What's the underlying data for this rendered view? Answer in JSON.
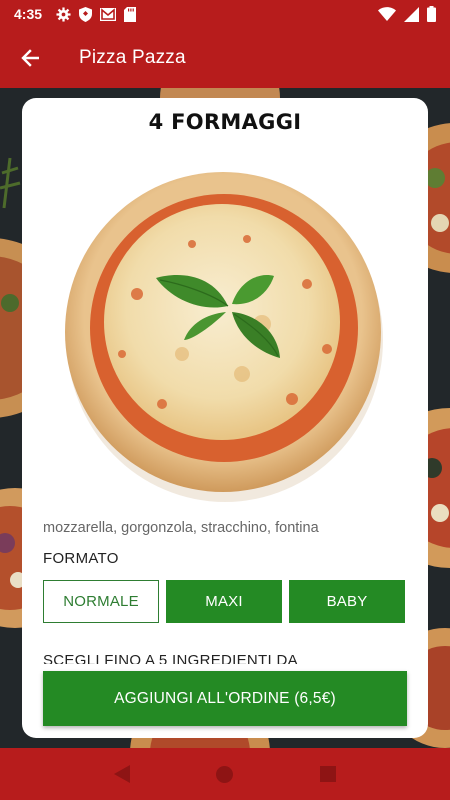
{
  "status_bar": {
    "time": "4:35",
    "left_icons": [
      "gear-icon",
      "shield-icon",
      "gmail-icon",
      "sd-card-icon"
    ],
    "right_icons": [
      "wifi-icon",
      "signal-icon",
      "battery-icon"
    ]
  },
  "app_bar": {
    "title": "Pizza Pazza",
    "back_icon": "arrow-left-icon"
  },
  "colors": {
    "primary": "#b71c1c",
    "accent_green": "#248a24"
  },
  "product": {
    "name": "4 FORMAGGI",
    "ingredients": "mozzarella, gorgonzola, stracchino, fontina",
    "format_label": "FORMATO",
    "sizes": [
      {
        "label": "NORMALE",
        "selected": false
      },
      {
        "label": "MAXI",
        "selected": true
      },
      {
        "label": "BABY",
        "selected": true
      }
    ],
    "choose_label": "SCEGLI FINO A 5 INGREDIENTI DA",
    "add_button_label": "AGGIUNGI ALL'ORDINE (6,5€)"
  },
  "nav_bar": {
    "buttons": [
      "back-triangle-icon",
      "home-circle-icon",
      "recents-square-icon"
    ]
  }
}
